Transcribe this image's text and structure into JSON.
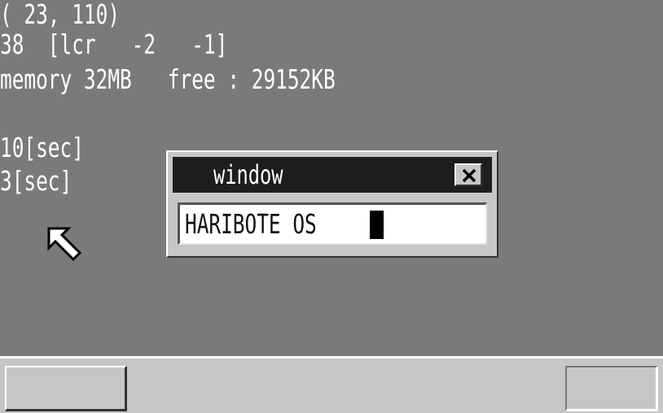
{
  "desktop": {
    "mouse_coords": "( 23, 110)",
    "mouse_data": "38  [lcr   -2   -1]",
    "memory_info": "memory 32MB   free : 29152KB",
    "timer_10": "10[sec]",
    "timer_3": "3[sec]",
    "background_color": "#7a7a7a",
    "cursor_icon": "arrow-pointer-icon"
  },
  "window": {
    "title": "window",
    "close_icon": "close-icon",
    "textbox_value": "HARIBOTE OS",
    "title_bar_color": "#1e1e1e",
    "frame_color": "#c6c6c6"
  },
  "taskbar": {
    "color": "#c6c6c6",
    "start_button_label": "",
    "tray_label": ""
  }
}
